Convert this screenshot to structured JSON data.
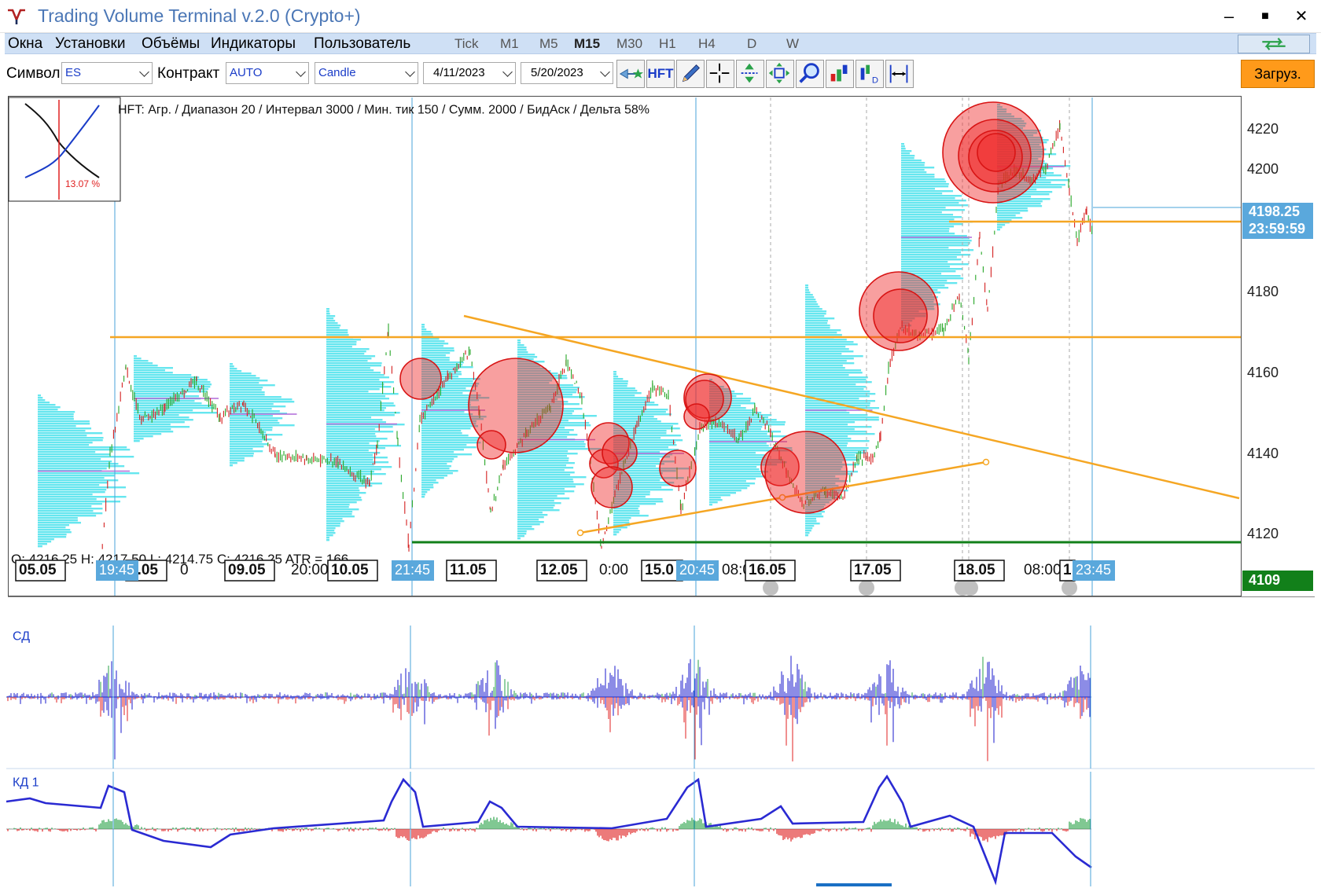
{
  "window": {
    "title": "Trading Volume Terminal v.2.0 (Crypto+)",
    "minimize_glyph": "–",
    "maximize_glyph": "■",
    "close_glyph": "✕"
  },
  "menu": {
    "items": [
      "Окна",
      "Установки",
      "Объёмы",
      "Индикаторы",
      "Пользователь"
    ],
    "timeframes": [
      "Tick",
      "M1",
      "M5",
      "M15",
      "M30",
      "H1",
      "H4",
      "D",
      "W"
    ],
    "active_timeframe": "M15"
  },
  "toolbar": {
    "symbol_label": "Символ",
    "symbol_value": "ES",
    "contract_label": "Контракт",
    "contract_value": "AUTO",
    "chart_type": "Candle",
    "date_from": "4/11/2023",
    "date_to": "5/20/2023",
    "hft_label": "HFT",
    "load_button": "Загруз."
  },
  "chart": {
    "info_line": "HFT: Агр. / Диапазон 20 / Интервал 3000 / Мин. тик 150 / Сумм. 2000 / БидАск / Дельта 58%",
    "ohlc_line": "O: 4216.25   H: 4217.50   L: 4214.75   C: 4216.25   ATR = 166",
    "thumbnail_percent": "13.07 %",
    "current_price": "4198.25",
    "countdown": "23:59:59",
    "support_price": "4109",
    "price_axis": {
      "labels": [
        "4220",
        "4200",
        "4180",
        "4160",
        "4140",
        "4120"
      ],
      "min": 4106,
      "max": 4226
    },
    "time_axis": {
      "labels": [
        "05.05",
        "3.05",
        "0",
        "09.05",
        "20:00",
        "10.05",
        "11.05",
        "12.05",
        "0:00",
        "15.0",
        "08:0",
        "16.05",
        "17.05",
        "18.05",
        "08:00",
        "1"
      ],
      "cursor_labels": [
        "19:45",
        "21:45",
        "20:45",
        "23:45"
      ]
    },
    "colors": {
      "candle_up": "#26a626",
      "candle_down": "#d42020",
      "profile": "#66e6ef",
      "trendline": "#f5a623",
      "cluster": "#ef2b2b",
      "support": "#12801a",
      "axis_badge": "#5aa8dc"
    }
  },
  "indicators": [
    {
      "label": "СД"
    },
    {
      "label": "КД 1"
    }
  ]
}
